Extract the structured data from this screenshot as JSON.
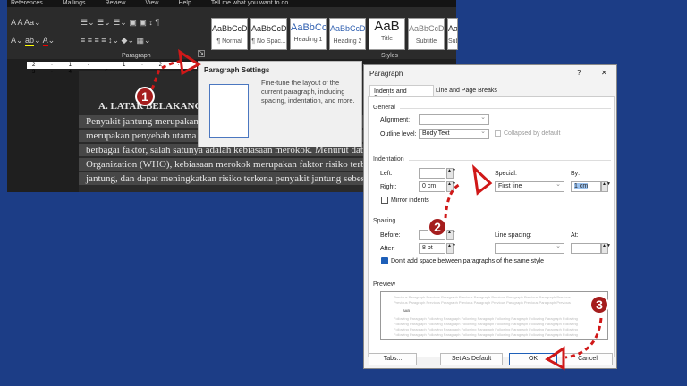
{
  "menu": [
    "References",
    "Mailings",
    "Review",
    "View",
    "Help",
    "Tell me what you want to do"
  ],
  "ribbon": {
    "group_paragraph": "Paragraph",
    "group_styles": "Styles",
    "styles": [
      {
        "preview": "AaBbCcDd",
        "name": "¶ Normal"
      },
      {
        "preview": "AaBbCcDd",
        "name": "¶ No Spac..."
      },
      {
        "preview": "AaBbCc",
        "name": "Heading 1"
      },
      {
        "preview": "AaBbCcD",
        "name": "Heading 2"
      },
      {
        "preview": "AaB",
        "name": "Title"
      },
      {
        "preview": "AaBbCcD",
        "name": "Subtitle"
      },
      {
        "preview": "AaB",
        "name": "Subt"
      }
    ]
  },
  "ruler": "2 · 1 · · 1 · 2 · 3 · 4 · 5",
  "document": {
    "heading": "A.  LATAR BELAKANG",
    "lines": [
      "Penyakit jantung merupakan salah",
      "merupakan penyebab utama kemat",
      "berbagai faktor, salah satunya adalah kebiasaan merokok. Menurut data dari W",
      "Organization (WHO), kebiasaan merokok merupakan faktor risiko terbesar terke",
      "jantung, dan dapat meningkatkan risiko terkena penyakit jantung sebesar 50%."
    ]
  },
  "tooltip": {
    "title": "Paragraph Settings",
    "desc": "Fine-tune the layout of the current paragraph, including spacing, indentation, and more."
  },
  "dialog": {
    "title": "Paragraph",
    "help": "?",
    "close": "✕",
    "tabs": [
      "Indents and Spacing",
      "Line and Page Breaks"
    ],
    "general": "General",
    "alignment_label": "Alignment:",
    "alignment_value": "",
    "outline_label": "Outline level:",
    "outline_value": "Body Text",
    "collapsed_label": "Collapsed by default",
    "indentation": "Indentation",
    "left_label": "Left:",
    "left_value": "",
    "right_label": "Right:",
    "right_value": "0 cm",
    "special_label": "Special:",
    "special_value": "First line",
    "by_label": "By:",
    "by_value": "1 cm",
    "mirror_label": "Mirror indents",
    "spacing": "Spacing",
    "before_label": "Before:",
    "before_value": "",
    "after_label": "After:",
    "after_value": "8 pt",
    "line_spacing_label": "Line spacing:",
    "line_spacing_value": "",
    "at_label": "At:",
    "at_value": "",
    "dont_add_label": "Don't add space between paragraphs of the same style",
    "preview": "Preview",
    "preview_prev": "Previous Paragraph Previous Paragraph Previous Paragraph Previous Paragraph Previous Paragraph Previous",
    "preview_sample": "BAB I",
    "preview_follow": "Following Paragraph Following Paragraph Following Paragraph Following Paragraph Following Paragraph Following",
    "tabs_button": "Tabs...",
    "default_button": "Set As Default",
    "ok_button": "OK",
    "cancel_button": "Cancel"
  },
  "badges": [
    "1",
    "2",
    "3"
  ],
  "colors": {
    "background": "#1c3d86",
    "accent": "#a51d1d",
    "checkbox": "#1e5fb8"
  }
}
